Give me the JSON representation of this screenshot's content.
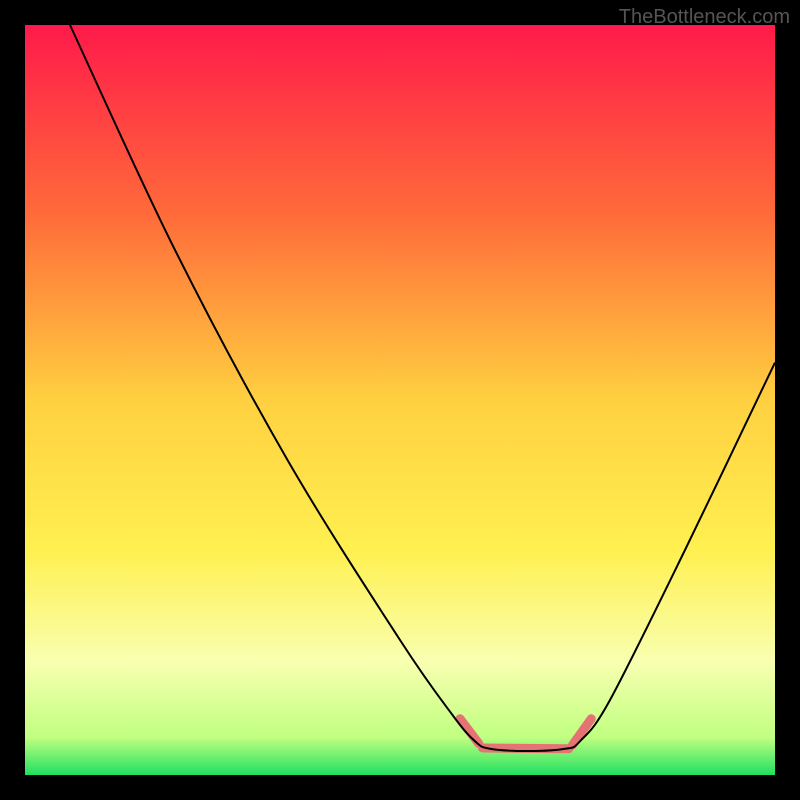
{
  "watermark": "TheBottleneck.com",
  "chart_data": {
    "type": "line",
    "title": "",
    "xlabel": "",
    "ylabel": "",
    "xlim": [
      0,
      100
    ],
    "ylim": [
      0,
      100
    ],
    "background_gradient": {
      "stops": [
        {
          "offset": 0,
          "color": "#ff1a4a"
        },
        {
          "offset": 25,
          "color": "#ff6a3a"
        },
        {
          "offset": 50,
          "color": "#ffd040"
        },
        {
          "offset": 70,
          "color": "#fff050"
        },
        {
          "offset": 85,
          "color": "#f8ffb0"
        },
        {
          "offset": 95,
          "color": "#c0ff80"
        },
        {
          "offset": 100,
          "color": "#20e060"
        }
      ]
    },
    "series": [
      {
        "name": "bottleneck-curve",
        "type": "line",
        "color": "#000000",
        "points": [
          {
            "x": 6,
            "y": 100
          },
          {
            "x": 20,
            "y": 70
          },
          {
            "x": 35,
            "y": 42
          },
          {
            "x": 50,
            "y": 18
          },
          {
            "x": 57,
            "y": 8
          },
          {
            "x": 60,
            "y": 4.5
          },
          {
            "x": 62,
            "y": 3.5
          },
          {
            "x": 67,
            "y": 3.2
          },
          {
            "x": 72,
            "y": 3.5
          },
          {
            "x": 74,
            "y": 4.5
          },
          {
            "x": 78,
            "y": 10
          },
          {
            "x": 88,
            "y": 30
          },
          {
            "x": 100,
            "y": 55
          }
        ]
      },
      {
        "name": "optimal-zone-marker",
        "type": "segments",
        "color": "#e57373",
        "stroke_width": 9,
        "segments": [
          [
            {
              "x": 58,
              "y": 7.5
            },
            {
              "x": 60.5,
              "y": 4.2
            }
          ],
          [
            {
              "x": 61,
              "y": 3.6
            },
            {
              "x": 72.5,
              "y": 3.5
            }
          ],
          [
            {
              "x": 73,
              "y": 4
            },
            {
              "x": 75.5,
              "y": 7.5
            }
          ]
        ]
      }
    ]
  }
}
